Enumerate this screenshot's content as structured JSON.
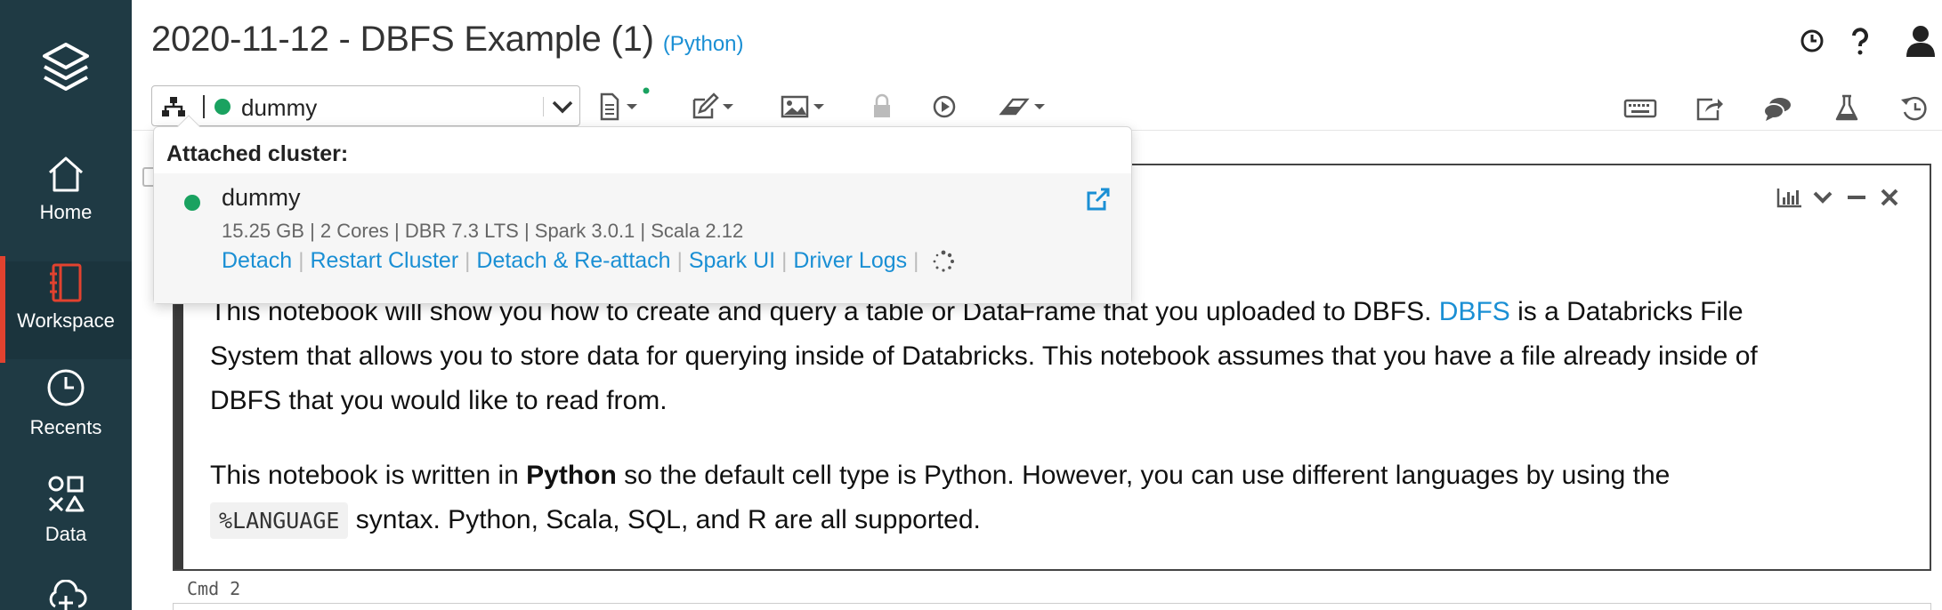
{
  "sidebar": {
    "items": [
      {
        "label": "Home",
        "icon": "home-icon"
      },
      {
        "label": "Workspace",
        "icon": "workspace-icon"
      },
      {
        "label": "Recents",
        "icon": "clock-icon"
      },
      {
        "label": "Data",
        "icon": "data-icon"
      }
    ]
  },
  "header": {
    "title": "2020-11-12 - DBFS Example (1)",
    "language": "(Python)"
  },
  "toolbar": {
    "cluster_name": "dummy",
    "cluster_status_color": "#1aa260"
  },
  "popover": {
    "heading": "Attached cluster:",
    "cluster_name": "dummy",
    "meta": "15.25 GB | 2 Cores | DBR 7.3 LTS | Spark 3.0.1 | Scala 2.12",
    "links": [
      "Detach",
      "Restart Cluster",
      "Detach & Re-attach",
      "Spark UI",
      "Driver Logs"
    ]
  },
  "cell": {
    "para1_line1_pre": "This notebook will show you how to create and query a table or DataFrame that you uploaded to DBFS. ",
    "para1_link": "DBFS",
    "para1_line1_post": " is a Databricks File",
    "para1_line2": "System that allows you to store data for querying inside of Databricks. This notebook assumes that you have a file already inside of",
    "para1_line3": "DBFS that you would like to read from.",
    "para2_pre": "This notebook is written in ",
    "para2_bold": "Python",
    "para2_post": " so the default cell type is Python. However, you can use different languages by using the",
    "para2_code": "%LANGUAGE",
    "para2_end": " syntax. Python, Scala, SQL, and R are all supported."
  },
  "cmd_label": "Cmd 2",
  "colors": {
    "sidebar_bg": "#1f3a44",
    "active_accent": "#e2422f",
    "link": "#1a8fd4",
    "status_green": "#1aa260"
  }
}
